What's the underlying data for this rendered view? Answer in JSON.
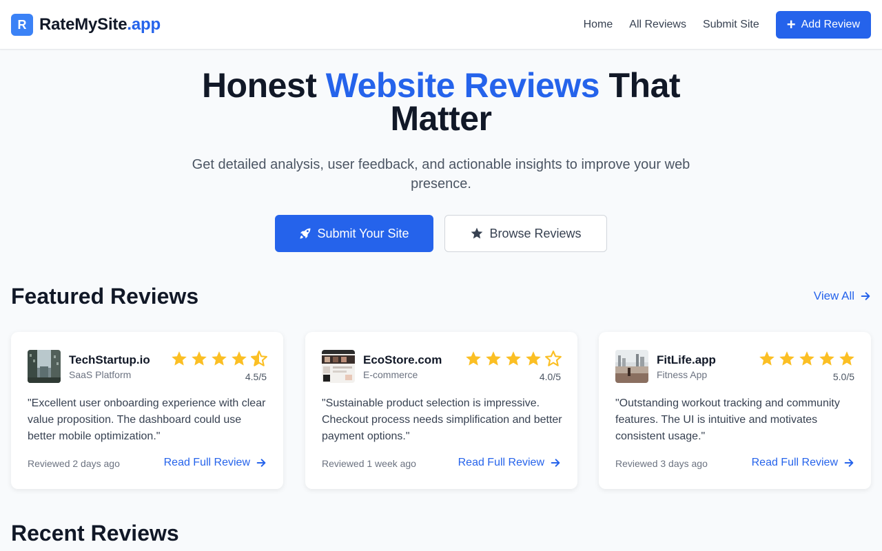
{
  "header": {
    "logo_letter": "R",
    "brand_name": "RateMySite",
    "brand_suffix": ".app",
    "nav": [
      "Home",
      "All Reviews",
      "Submit Site"
    ],
    "add_review_label": "Add Review"
  },
  "hero": {
    "title_part1": "Honest ",
    "title_accent": "Website Reviews",
    "title_part2": " That Matter",
    "subtitle": "Get detailed analysis, user feedback, and actionable insights to improve your web presence.",
    "primary_button": "Submit Your Site",
    "secondary_button": "Browse Reviews"
  },
  "featured": {
    "title": "Featured Reviews",
    "view_all": "View All",
    "cards": [
      {
        "site": "TechStartup.io",
        "category": "SaaS Platform",
        "rating": 4.5,
        "rating_label": "4.5/5",
        "quote": "\"Excellent user onboarding experience with clear value proposition. The dashboard could use better mobile optimization.\"",
        "reviewed": "Reviewed 2 days ago",
        "read_more": "Read Full Review"
      },
      {
        "site": "EcoStore.com",
        "category": "E-commerce",
        "rating": 4.0,
        "rating_label": "4.0/5",
        "quote": "\"Sustainable product selection is impressive. Checkout process needs simplification and better payment options.\"",
        "reviewed": "Reviewed 1 week ago",
        "read_more": "Read Full Review"
      },
      {
        "site": "FitLife.app",
        "category": "Fitness App",
        "rating": 5.0,
        "rating_label": "5.0/5",
        "quote": "\"Outstanding workout tracking and community features. The UI is intuitive and motivates consistent usage.\"",
        "reviewed": "Reviewed 3 days ago",
        "read_more": "Read Full Review"
      }
    ]
  },
  "recent": {
    "title": "Recent Reviews"
  },
  "colors": {
    "accent": "#2563eb",
    "star": "#fbbf24"
  }
}
